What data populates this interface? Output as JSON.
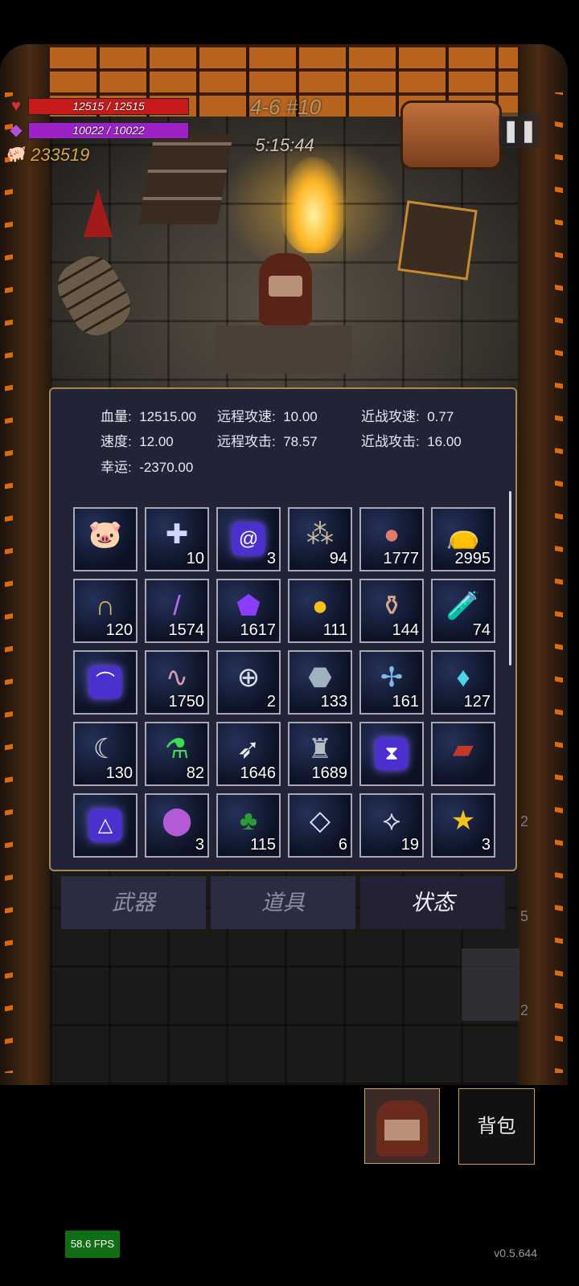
{
  "hud": {
    "hp": "12515 / 12515",
    "mp": "10022 / 10022",
    "gold": "233519",
    "level": "4-6 #10",
    "timer": "5:15:44",
    "pause_icon": "pause-icon"
  },
  "stats": [
    {
      "label": "血量:",
      "value": "12515.00"
    },
    {
      "label": "远程攻速:",
      "value": "10.00"
    },
    {
      "label": "近战攻速:",
      "value": "0.77"
    },
    {
      "label": "速度:",
      "value": "12.00"
    },
    {
      "label": "远程攻击:",
      "value": "78.57"
    },
    {
      "label": "近战攻击:",
      "value": "16.00"
    },
    {
      "label": "幸运:",
      "value": "-2370.00"
    }
  ],
  "items": [
    {
      "icon": "piggy-bank-icon",
      "count": ""
    },
    {
      "icon": "medkit-icon",
      "count": "10"
    },
    {
      "icon": "spiral-rune-icon",
      "count": "3"
    },
    {
      "icon": "pebbles-icon",
      "count": "94"
    },
    {
      "icon": "apple-icon",
      "count": "1777"
    },
    {
      "icon": "gold-sack-icon",
      "count": "2995"
    },
    {
      "icon": "horseshoe-icon",
      "count": "120"
    },
    {
      "icon": "purple-wand-icon",
      "count": "1574"
    },
    {
      "icon": "purple-gem-icon",
      "count": "1617"
    },
    {
      "icon": "gold-coin-icon",
      "count": "111"
    },
    {
      "icon": "vase-icon",
      "count": "144"
    },
    {
      "icon": "potion-bottle-icon",
      "count": "74"
    },
    {
      "icon": "curve-rune-icon",
      "count": ""
    },
    {
      "icon": "worm-icon",
      "count": "1750"
    },
    {
      "icon": "health-ring-icon",
      "count": "2"
    },
    {
      "icon": "rock-icon",
      "count": "133"
    },
    {
      "icon": "dragonfly-icon",
      "count": "161"
    },
    {
      "icon": "blue-crystal-icon",
      "count": "127"
    },
    {
      "icon": "horn-icon",
      "count": "130"
    },
    {
      "icon": "green-flask-icon",
      "count": "82"
    },
    {
      "icon": "feather-icon",
      "count": "1646"
    },
    {
      "icon": "statue-icon",
      "count": "1689"
    },
    {
      "icon": "hourglass-rune-icon",
      "count": ""
    },
    {
      "icon": "spellbook-icon",
      "count": ""
    },
    {
      "icon": "triangle-rune-icon",
      "count": ""
    },
    {
      "icon": "purple-slime-icon",
      "count": "3"
    },
    {
      "icon": "clover-icon",
      "count": "115"
    },
    {
      "icon": "diamond-tile-icon",
      "count": "6"
    },
    {
      "icon": "cross-tile-icon",
      "count": "19"
    },
    {
      "icon": "star-trophy-icon",
      "count": "3"
    }
  ],
  "tabs": [
    "武器",
    "道具",
    "状态"
  ],
  "bag_label": "背包",
  "fps": "58.6 FPS",
  "version": "v0.5.644",
  "side_counts": [
    "2",
    "5",
    "2"
  ]
}
